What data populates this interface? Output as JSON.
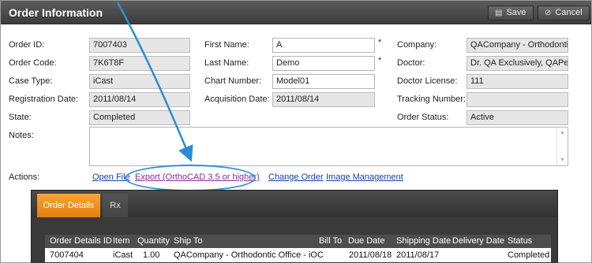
{
  "header": {
    "title": "Order Information",
    "save_label": "Save",
    "cancel_label": "Cancel"
  },
  "fields": {
    "order_id": {
      "label": "Order ID:",
      "value": "7007403"
    },
    "order_code": {
      "label": "Order Code:",
      "value": "7K6T8F"
    },
    "case_type": {
      "label": "Case Type:",
      "value": "iCast"
    },
    "registration_date": {
      "label": "Registration Date:",
      "value": "2011/08/14"
    },
    "state": {
      "label": "State:",
      "value": "Completed"
    },
    "first_name": {
      "label": "First Name:",
      "value": "A"
    },
    "last_name": {
      "label": "Last Name:",
      "value": "Demo"
    },
    "chart_number": {
      "label": "Chart Number:",
      "value": "Model01"
    },
    "acquisition_date": {
      "label": "Acquisition Date:",
      "value": "2011/08/14"
    },
    "company": {
      "label": "Company:",
      "value": "QACompany - Orthodontic"
    },
    "doctor": {
      "label": "Doctor:",
      "value": "Dr. QA Exclusively, QAPerso"
    },
    "doctor_license": {
      "label": "Doctor License:",
      "value": "111"
    },
    "tracking_number": {
      "label": "Tracking Number:",
      "value": ""
    },
    "order_status": {
      "label": "Order Status:",
      "value": "Active"
    },
    "notes": {
      "label": "Notes:",
      "value": ""
    },
    "required_mark": "*"
  },
  "actions": {
    "label": "Actions:",
    "open_file": "Open File",
    "export": "Export (OrthoCAD 3.5 or higher)",
    "change_order": "Change Order",
    "image_management": "Image Management"
  },
  "details": {
    "tabs": [
      "Order Details",
      "Rx"
    ],
    "columns": [
      "Order Details ID",
      "Item",
      "Quantity",
      "Ship To",
      "Bill To",
      "Due Date",
      "Shipping Date",
      "Delivery Date",
      "Status"
    ],
    "rows": [
      [
        "7007404",
        "iCast",
        "1.00",
        "QACompany - Orthodontic Office - iOC",
        "",
        "2011/08/18",
        "2011/08/17",
        "",
        "Completed"
      ]
    ]
  },
  "colors": {
    "titlebar": "#4a4a4a",
    "tab_active": "#f39a2a",
    "annotation": "#2a8fd0"
  }
}
